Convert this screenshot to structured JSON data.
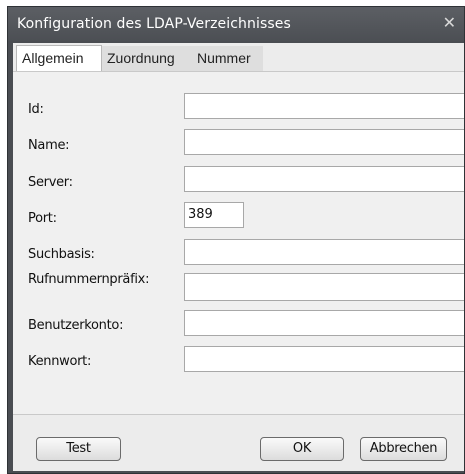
{
  "window": {
    "title": "Konfiguration des LDAP-Verzeichnisses",
    "close_glyph": "✕"
  },
  "tabs": [
    {
      "label": "Allgemein",
      "active": true
    },
    {
      "label": "Zuordnung",
      "active": false
    },
    {
      "label": "Nummer",
      "active": false
    }
  ],
  "form": {
    "fields": [
      {
        "label": "Id:",
        "value": ""
      },
      {
        "label": "Name:",
        "value": ""
      },
      {
        "label": "Server:",
        "value": ""
      },
      {
        "label": "Port:",
        "value": "389"
      },
      {
        "label": "Suchbasis:",
        "value": ""
      },
      {
        "label": "Rufnummernpräfix:",
        "value": ""
      },
      {
        "label": "Benutzerkonto:",
        "value": ""
      },
      {
        "label": "Kennwort:",
        "value": ""
      }
    ]
  },
  "buttons": {
    "test": "Test",
    "ok": "OK",
    "cancel": "Abbrechen"
  },
  "colors": {
    "titlebar": "#4c4f54",
    "panel": "#f0f0f0"
  }
}
